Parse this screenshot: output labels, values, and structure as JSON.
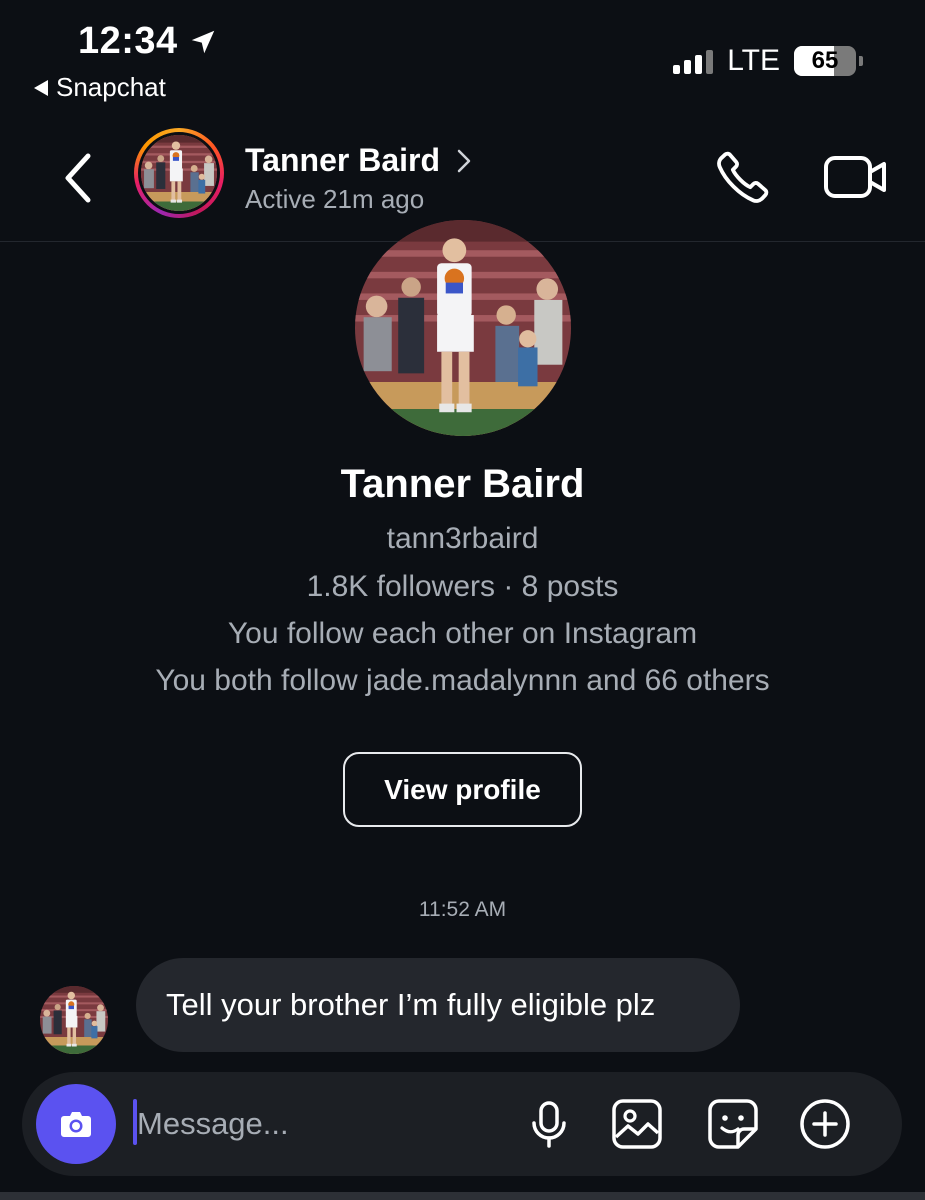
{
  "status_bar": {
    "time": "12:34",
    "back_app": "Snapchat",
    "network": "LTE",
    "battery": "65",
    "battery_level": 0.65,
    "icons": [
      "location-arrow-icon",
      "signal-icon",
      "battery-icon"
    ]
  },
  "header": {
    "name": "Tanner Baird",
    "status": "Active 21m ago",
    "icons": [
      "back-chevron-icon",
      "chevron-right-icon",
      "phone-icon",
      "video-camera-icon"
    ]
  },
  "profile": {
    "name": "Tanner Baird",
    "username": "tann3rbaird",
    "stats": "1.8K followers · 8 posts",
    "follow_status": "You follow each other on Instagram",
    "mutuals": "You both follow jade.madalynnn and 66 others",
    "view_profile_label": "View profile"
  },
  "conversation": {
    "timestamp": "11:52 AM",
    "messages": [
      {
        "text": "Tell your brother I’m fully eligible plz"
      }
    ]
  },
  "composer": {
    "placeholder": "Message...",
    "icons": [
      "camera-icon",
      "microphone-icon",
      "gallery-icon",
      "sticker-icon",
      "plus-icon"
    ]
  },
  "colors": {
    "background": "#0c0f14",
    "bubble": "#24272d",
    "composer": "#1c1f24",
    "accent": "#5b52f0",
    "secondary_text": "#a7adb5"
  }
}
